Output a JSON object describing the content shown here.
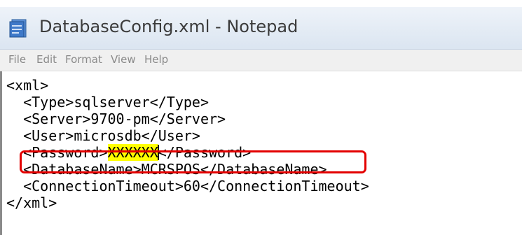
{
  "window": {
    "title": "DatabaseConfig.xml - Notepad",
    "icon": "notepad-icon"
  },
  "menu": {
    "items": [
      "File",
      "Edit",
      "Format",
      "View",
      "Help"
    ]
  },
  "editor": {
    "lines": [
      "<xml>",
      "  <Type>sqlserver</Type>",
      "  <Server>9700-pm</Server>",
      "  <User>microsdb</User>",
      "  <Password>",
      "XXXXXX",
      "</Password>",
      "  <DatabaseName>MCRSPOS</DatabaseName>",
      "  <ConnectionTimeout>60</ConnectionTimeout>",
      "</xml>"
    ],
    "highlighted_text": "XXXXXX"
  },
  "annotation": {
    "color": "#e30000",
    "highlight_color": "#ffff00"
  }
}
